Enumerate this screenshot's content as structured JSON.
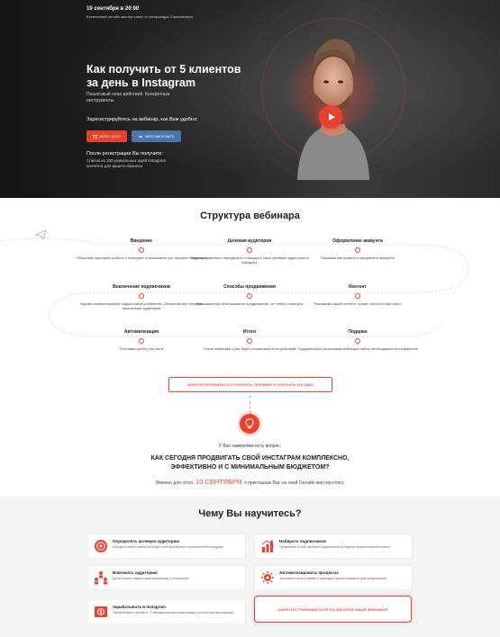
{
  "hero": {
    "date": "10 сентября в 20:00",
    "subtitle": "Бесплатный онлайн-мастер класс от Александра Соколовского",
    "title": "Как получить от 5 клиентов за день в Instagram",
    "description": "Пошаговый план действий. Конкретные инструменты.",
    "register_prompt": "Зарегистрируйтесь на вебинар, как Вам удобно:",
    "mail_button": "ЧЕРЕЗ ПОЧТУ",
    "vk_button": "ЧЕРЕЗ ВКОНТАКТЕ",
    "after_title": "После регистрации Вы получите:",
    "after_desc": "Список из 100 уникальных идей Instagram контента для вашего бизнеса",
    "accent_color": "#e8412f"
  },
  "structure": {
    "title": "Структура вебинара",
    "nodes": [
      {
        "title": "Введение",
        "desc": "Объясним принципы работы с Instagram и расскажем про текущие тенденции"
      },
      {
        "title": "Целевая аудитория",
        "desc": "Научим правильно определять и находить свою целевую аудиторию в Instagram"
      },
      {
        "title": "Оформление аккаунта",
        "desc": "Покажем как грамотно оформлять аккаунты"
      },
      {
        "title": "Вовлечение подписчиков",
        "desc": "Научим конвертировать подписчиков в клиентов. Объясним как получать аппетитную аудиторию"
      },
      {
        "title": "Способы продвижения",
        "desc": "Расскажем про все варианты продвижения, их плюсы и минусы"
      },
      {
        "title": "Контент",
        "desc": "Расскажем какой контент лучше постить и как часто"
      },
      {
        "title": "Автоматизация",
        "desc": "Поставим работу на поток"
      },
      {
        "title": "Итоги",
        "desc": "После вебинара у вас будет пошаговый план действий"
      },
      {
        "title": "Подарки",
        "desc": "Подарим всем участникам вебинара набор необходимых инструментов"
      }
    ],
    "cta": "ЗАРЕГИСТРИРОВАТЬСЯ И ПОЛУЧИТЬ ТРИПВАЙР И ПОЛУЧИТЬ 100 ИДЕЙ"
  },
  "question": {
    "pre": "У Вас наверняка есть вопрос:",
    "main": "КАК СЕГОДНЯ ПРОДВИГАТЬ СВОЙ ИНСТАГРАМ КОМПЛЕКСНО, ЭФФЕКТИВНО И С МИНИМАЛЬНЫМ БЮДЖЕТОМ?",
    "invite_before": "Именно для этого,",
    "invite_date": "10 СЕНТЯБРЯ",
    "invite_after": ", я приглашаю Вас на свой Онлайн мастер-класс"
  },
  "learn": {
    "title": "Чему Вы научитесь?",
    "cards": [
      {
        "icon": "target-icon",
        "title": "Определять целевую аудиторию",
        "desc": "Находить своих клиентов среди сотен миллионов пользователей Instagram"
      },
      {
        "icon": "growth-icon",
        "title": "Набирать подписчиков",
        "desc": "Привлекать от 500 целевых подписчиков за неделю практически бесплатно"
      },
      {
        "icon": "audience-icon",
        "title": "Вовлекать аудиторию",
        "desc": "Делать своих подписчиков активными и лояльными"
      },
      {
        "icon": "automation-icon",
        "title": "Автоматизировать процессы",
        "desc": "Экономить силы и время с помощью нужных сервисов для продвижения"
      },
      {
        "icon": "money-icon",
        "title": "Зарабатывать в Instagram",
        "desc": "Зарабатывать системно. С минимальными вложениями и полной автоматизацией."
      }
    ],
    "cta": "ЗАРЕГИСТРИРОВАТЬСЯ НА БЕСПЛАТНЫЙ ВЕБИНАР"
  }
}
